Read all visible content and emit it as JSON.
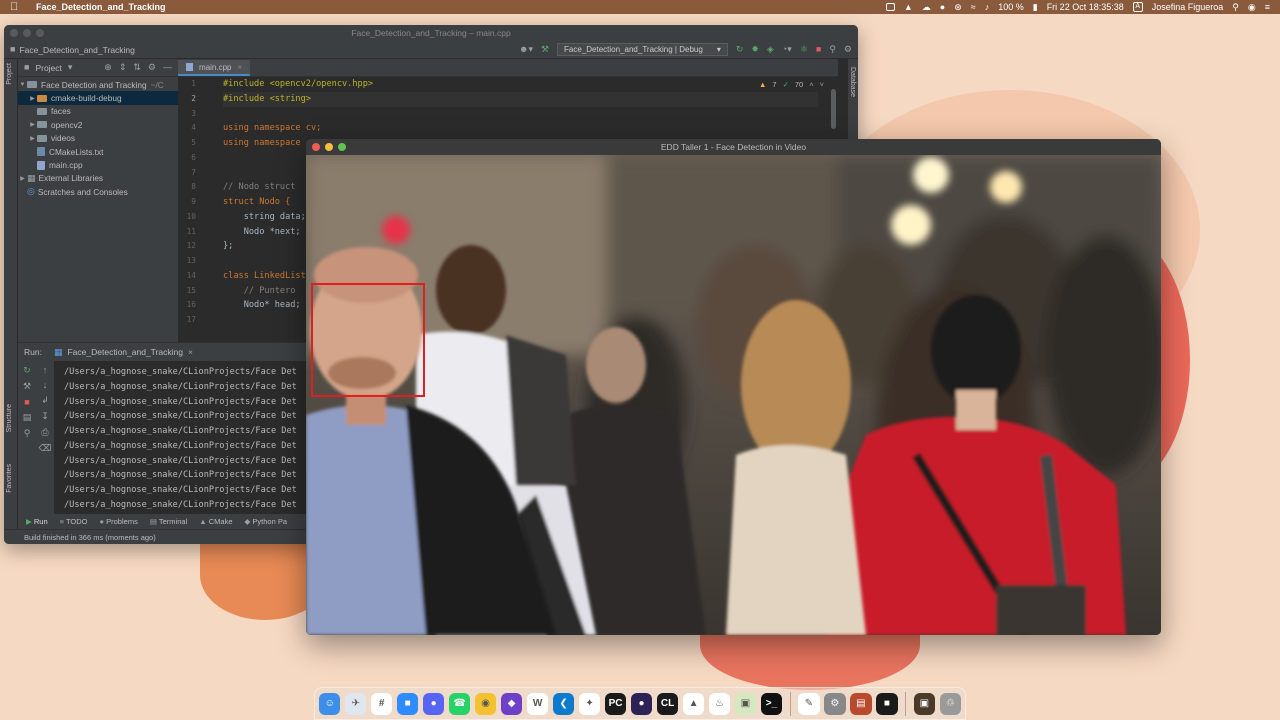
{
  "menubar": {
    "app_name": "Face_Detection_and_Tracking",
    "battery": "100 %",
    "datetime": "Fri 22 Oct  18:35:38",
    "input_source": "A",
    "user": "Josefina Figueroa"
  },
  "ide": {
    "window_title": "Face_Detection_and_Tracking – main.cpp",
    "project_name": "Face_Detection_and_Tracking",
    "run_config": "Face_Detection_and_Tracking | Debug",
    "project_panel_label": "Project",
    "left_tab_project": "Project",
    "left_tab_structure": "Structure",
    "left_tab_favorites": "Favorites",
    "right_tab_database": "Database",
    "tree": [
      {
        "label": "Face Detection and Tracking",
        "path": "~/C",
        "type": "root-folder"
      },
      {
        "label": "cmake-build-debug",
        "type": "folder-orange",
        "selected": true
      },
      {
        "label": "faces",
        "type": "folder"
      },
      {
        "label": "opencv2",
        "type": "folder"
      },
      {
        "label": "videos",
        "type": "folder"
      },
      {
        "label": "CMakeLists.txt",
        "type": "file"
      },
      {
        "label": "main.cpp",
        "type": "file-cpp"
      },
      {
        "label": "External Libraries",
        "type": "lib"
      },
      {
        "label": "Scratches and Consoles",
        "type": "scratch"
      }
    ],
    "editor_tab": "main.cpp",
    "inspections": {
      "warnings": "7",
      "ok": "70"
    },
    "line_numbers": [
      "1",
      "2",
      "3",
      "4",
      "5",
      "6",
      "7",
      "8",
      "9",
      "10",
      "11",
      "12",
      "13",
      "14",
      "15",
      "16",
      "17"
    ],
    "code_lines": [
      "#include <opencv2/opencv.hpp>",
      "#include <string>",
      "",
      "using namespace cv;",
      "using namespace",
      "",
      "",
      "// Nodo struct ",
      "struct Nodo {",
      "    string data;",
      "    Nodo *next;",
      "};",
      "",
      "class LinkedList",
      "    // Puntero ",
      "    Nodo* head;",
      ""
    ],
    "run_label": "Run:",
    "run_tab": "Face_Detection_and_Tracking",
    "console_lines": [
      "/Users/a_hognose_snake/CLionProjects/Face Det",
      "/Users/a_hognose_snake/CLionProjects/Face Det",
      "/Users/a_hognose_snake/CLionProjects/Face Det",
      "/Users/a_hognose_snake/CLionProjects/Face Det",
      "/Users/a_hognose_snake/CLionProjects/Face Det",
      "/Users/a_hognose_snake/CLionProjects/Face Det",
      "/Users/a_hognose_snake/CLionProjects/Face Det",
      "/Users/a_hognose_snake/CLionProjects/Face Det",
      "/Users/a_hognose_snake/CLionProjects/Face Det",
      "/Users/a_hognose_snake/CLionProjects/Face Det"
    ],
    "bottom_tabs": [
      "Run",
      "TODO",
      "Problems",
      "Terminal",
      "CMake",
      "Python Pa"
    ],
    "status": "Build finished in 366 ms (moments ago)"
  },
  "video_window": {
    "title": "EDD Taller 1 - Face Detection in Video"
  },
  "dock": {
    "apps": [
      {
        "name": "finder",
        "color": "#3d8ee8",
        "glyph": "☺"
      },
      {
        "name": "safari",
        "color": "#dfe6ee",
        "glyph": "✈"
      },
      {
        "name": "slack",
        "color": "#ffffff",
        "glyph": "#"
      },
      {
        "name": "zoom",
        "color": "#2d8cff",
        "glyph": "■"
      },
      {
        "name": "discord",
        "color": "#5865f2",
        "glyph": "●"
      },
      {
        "name": "whatsapp",
        "color": "#25d366",
        "glyph": "☎"
      },
      {
        "name": "chrome",
        "color": "#f2c230",
        "glyph": "◉"
      },
      {
        "name": "github",
        "color": "#6e40c9",
        "glyph": "◆"
      },
      {
        "name": "word",
        "color": "#ffffff",
        "glyph": "W"
      },
      {
        "name": "vscode",
        "color": "#0e7acc",
        "glyph": "❮"
      },
      {
        "name": "gitkraken",
        "color": "#ffffff",
        "glyph": "✦"
      },
      {
        "name": "pycharm",
        "color": "#1a1a1a",
        "glyph": "PC"
      },
      {
        "name": "eclipse",
        "color": "#2c2255",
        "glyph": "●"
      },
      {
        "name": "clion",
        "color": "#1a1a1a",
        "glyph": "CL"
      },
      {
        "name": "postgres",
        "color": "#ffffff",
        "glyph": "▲"
      },
      {
        "name": "mysql",
        "color": "#ffffff",
        "glyph": "♨"
      },
      {
        "name": "netbeans",
        "color": "#d5e8c0",
        "glyph": "▣"
      },
      {
        "name": "terminal",
        "color": "#111111",
        "glyph": ">_"
      },
      {
        "name": "textedit",
        "color": "#ffffff",
        "glyph": "✎"
      },
      {
        "name": "system-preferences",
        "color": "#888888",
        "glyph": "⚙"
      },
      {
        "name": "calendar-app",
        "color": "#b84a2e",
        "glyph": "▤"
      },
      {
        "name": "terminal-2",
        "color": "#1a1a1a",
        "glyph": "■"
      },
      {
        "name": "photo-app",
        "color": "#4a3a2a",
        "glyph": "▣"
      },
      {
        "name": "trash",
        "color": "#9a9a9a",
        "glyph": "♲"
      }
    ]
  }
}
